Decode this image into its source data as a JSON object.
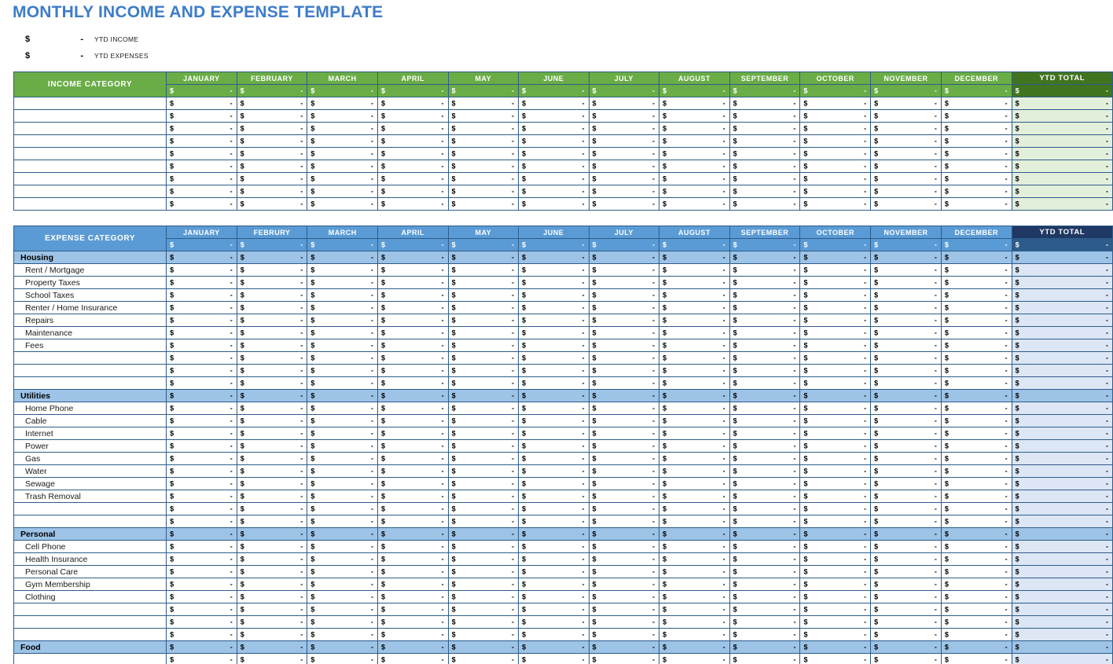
{
  "document": {
    "title": "MONTHLY INCOME AND EXPENSE TEMPLATE",
    "title_color": "#3d7cc9"
  },
  "summary": {
    "rows": [
      {
        "currency": "$",
        "amount": "-",
        "label": "YTD INCOME"
      },
      {
        "currency": "$",
        "amount": "-",
        "label": "YTD EXPENSES"
      }
    ]
  },
  "income_table": {
    "category_header": "INCOME CATEGORY",
    "months": [
      "JANUARY",
      "FEBRUARY",
      "MARCH",
      "APRIL",
      "MAY",
      "JUNE",
      "JULY",
      "AUGUST",
      "SEPTEMBER",
      "OCTOBER",
      "NOVEMBER",
      "DECEMBER"
    ],
    "ytd_header": "YTD TOTAL",
    "header_totals": [
      "-",
      "-",
      "-",
      "-",
      "-",
      "-",
      "-",
      "-",
      "-",
      "-",
      "-",
      "-"
    ],
    "ytd_header_total": "-",
    "currency": "$",
    "empty_value": "-",
    "theme": {
      "header_bg": "#6aad46",
      "ytd_header_bg": "#41741f",
      "ytd_cell_bg": "#e2efda",
      "border": "#2e5c8a"
    },
    "rows": [
      {
        "label": "",
        "values": [
          "-",
          "-",
          "-",
          "-",
          "-",
          "-",
          "-",
          "-",
          "-",
          "-",
          "-",
          "-"
        ],
        "ytd": "-"
      },
      {
        "label": "",
        "values": [
          "-",
          "-",
          "-",
          "-",
          "-",
          "-",
          "-",
          "-",
          "-",
          "-",
          "-",
          "-"
        ],
        "ytd": "-"
      },
      {
        "label": "",
        "values": [
          "-",
          "-",
          "-",
          "-",
          "-",
          "-",
          "-",
          "-",
          "-",
          "-",
          "-",
          "-"
        ],
        "ytd": "-"
      },
      {
        "label": "",
        "values": [
          "-",
          "-",
          "-",
          "-",
          "-",
          "-",
          "-",
          "-",
          "-",
          "-",
          "-",
          "-"
        ],
        "ytd": "-"
      },
      {
        "label": "",
        "values": [
          "-",
          "-",
          "-",
          "-",
          "-",
          "-",
          "-",
          "-",
          "-",
          "-",
          "-",
          "-"
        ],
        "ytd": "-"
      },
      {
        "label": "",
        "values": [
          "-",
          "-",
          "-",
          "-",
          "-",
          "-",
          "-",
          "-",
          "-",
          "-",
          "-",
          "-"
        ],
        "ytd": "-"
      },
      {
        "label": "",
        "values": [
          "-",
          "-",
          "-",
          "-",
          "-",
          "-",
          "-",
          "-",
          "-",
          "-",
          "-",
          "-"
        ],
        "ytd": "-"
      },
      {
        "label": "",
        "values": [
          "-",
          "-",
          "-",
          "-",
          "-",
          "-",
          "-",
          "-",
          "-",
          "-",
          "-",
          "-"
        ],
        "ytd": "-"
      },
      {
        "label": "",
        "values": [
          "-",
          "-",
          "-",
          "-",
          "-",
          "-",
          "-",
          "-",
          "-",
          "-",
          "-",
          "-"
        ],
        "ytd": "-"
      }
    ]
  },
  "expense_table": {
    "category_header": "EXPENSE CATEGORY",
    "months": [
      "JANUARY",
      "FEBRURY",
      "MARCH",
      "APRIL",
      "MAY",
      "JUNE",
      "JULY",
      "AUGUST",
      "SEPTEMBER",
      "OCTOBER",
      "NOVEMBER",
      "DECEMBER"
    ],
    "ytd_header": "YTD TOTAL",
    "header_totals": [
      "-",
      "-",
      "-",
      "-",
      "-",
      "-",
      "-",
      "-",
      "-",
      "-",
      "-",
      "-"
    ],
    "ytd_header_total": "-",
    "currency": "$",
    "empty_value": "-",
    "theme": {
      "header_bg": "#5b9bd5",
      "ytd_header_bg": "#1f3864",
      "ytd_cell_bg": "#dce6f4",
      "section_bg": "#9dc3e6",
      "border": "#2e5c8a"
    },
    "rows": [
      {
        "type": "section",
        "label": "Housing",
        "values": [
          "-",
          "-",
          "-",
          "-",
          "-",
          "-",
          "-",
          "-",
          "-",
          "-",
          "-",
          "-"
        ],
        "ytd": "-"
      },
      {
        "type": "item",
        "label": "Rent / Mortgage",
        "values": [
          "-",
          "-",
          "-",
          "-",
          "-",
          "-",
          "-",
          "-",
          "-",
          "-",
          "-",
          "-"
        ],
        "ytd": "-"
      },
      {
        "type": "item",
        "label": "Property Taxes",
        "values": [
          "-",
          "-",
          "-",
          "-",
          "-",
          "-",
          "-",
          "-",
          "-",
          "-",
          "-",
          "-"
        ],
        "ytd": "-"
      },
      {
        "type": "item",
        "label": "School Taxes",
        "values": [
          "-",
          "-",
          "-",
          "-",
          "-",
          "-",
          "-",
          "-",
          "-",
          "-",
          "-",
          "-"
        ],
        "ytd": "-"
      },
      {
        "type": "item",
        "label": "Renter / Home Insurance",
        "values": [
          "-",
          "-",
          "-",
          "-",
          "-",
          "-",
          "-",
          "-",
          "-",
          "-",
          "-",
          "-"
        ],
        "ytd": "-"
      },
      {
        "type": "item",
        "label": "Repairs",
        "values": [
          "-",
          "-",
          "-",
          "-",
          "-",
          "-",
          "-",
          "-",
          "-",
          "-",
          "-",
          "-"
        ],
        "ytd": "-"
      },
      {
        "type": "item",
        "label": "Maintenance",
        "values": [
          "-",
          "-",
          "-",
          "-",
          "-",
          "-",
          "-",
          "-",
          "-",
          "-",
          "-",
          "-"
        ],
        "ytd": "-"
      },
      {
        "type": "item",
        "label": "Fees",
        "values": [
          "-",
          "-",
          "-",
          "-",
          "-",
          "-",
          "-",
          "-",
          "-",
          "-",
          "-",
          "-"
        ],
        "ytd": "-"
      },
      {
        "type": "blank",
        "label": "",
        "values": [
          "-",
          "-",
          "-",
          "-",
          "-",
          "-",
          "-",
          "-",
          "-",
          "-",
          "-",
          "-"
        ],
        "ytd": "-"
      },
      {
        "type": "blank",
        "label": "",
        "values": [
          "-",
          "-",
          "-",
          "-",
          "-",
          "-",
          "-",
          "-",
          "-",
          "-",
          "-",
          "-"
        ],
        "ytd": "-"
      },
      {
        "type": "blank",
        "label": "",
        "values": [
          "-",
          "-",
          "-",
          "-",
          "-",
          "-",
          "-",
          "-",
          "-",
          "-",
          "-",
          "-"
        ],
        "ytd": "-"
      },
      {
        "type": "section",
        "label": "Utilities",
        "values": [
          "-",
          "-",
          "-",
          "-",
          "-",
          "-",
          "-",
          "-",
          "-",
          "-",
          "-",
          "-"
        ],
        "ytd": "-"
      },
      {
        "type": "item",
        "label": "Home Phone",
        "values": [
          "-",
          "-",
          "-",
          "-",
          "-",
          "-",
          "-",
          "-",
          "-",
          "-",
          "-",
          "-"
        ],
        "ytd": "-"
      },
      {
        "type": "item",
        "label": "Cable",
        "values": [
          "-",
          "-",
          "-",
          "-",
          "-",
          "-",
          "-",
          "-",
          "-",
          "-",
          "-",
          "-"
        ],
        "ytd": "-"
      },
      {
        "type": "item",
        "label": "Internet",
        "values": [
          "-",
          "-",
          "-",
          "-",
          "-",
          "-",
          "-",
          "-",
          "-",
          "-",
          "-",
          "-"
        ],
        "ytd": "-"
      },
      {
        "type": "item",
        "label": "Power",
        "values": [
          "-",
          "-",
          "-",
          "-",
          "-",
          "-",
          "-",
          "-",
          "-",
          "-",
          "-",
          "-"
        ],
        "ytd": "-"
      },
      {
        "type": "item",
        "label": "Gas",
        "values": [
          "-",
          "-",
          "-",
          "-",
          "-",
          "-",
          "-",
          "-",
          "-",
          "-",
          "-",
          "-"
        ],
        "ytd": "-"
      },
      {
        "type": "item",
        "label": "Water",
        "values": [
          "-",
          "-",
          "-",
          "-",
          "-",
          "-",
          "-",
          "-",
          "-",
          "-",
          "-",
          "-"
        ],
        "ytd": "-"
      },
      {
        "type": "item",
        "label": "Sewage",
        "values": [
          "-",
          "-",
          "-",
          "-",
          "-",
          "-",
          "-",
          "-",
          "-",
          "-",
          "-",
          "-"
        ],
        "ytd": "-"
      },
      {
        "type": "item",
        "label": "Trash Removal",
        "values": [
          "-",
          "-",
          "-",
          "-",
          "-",
          "-",
          "-",
          "-",
          "-",
          "-",
          "-",
          "-"
        ],
        "ytd": "-"
      },
      {
        "type": "blank",
        "label": "",
        "values": [
          "-",
          "-",
          "-",
          "-",
          "-",
          "-",
          "-",
          "-",
          "-",
          "-",
          "-",
          "-"
        ],
        "ytd": "-"
      },
      {
        "type": "blank",
        "label": "",
        "values": [
          "-",
          "-",
          "-",
          "-",
          "-",
          "-",
          "-",
          "-",
          "-",
          "-",
          "-",
          "-"
        ],
        "ytd": "-"
      },
      {
        "type": "section",
        "label": "Personal",
        "values": [
          "-",
          "-",
          "-",
          "-",
          "-",
          "-",
          "-",
          "-",
          "-",
          "-",
          "-",
          "-"
        ],
        "ytd": "-"
      },
      {
        "type": "item",
        "label": "Cell Phone",
        "values": [
          "-",
          "-",
          "-",
          "-",
          "-",
          "-",
          "-",
          "-",
          "-",
          "-",
          "-",
          "-"
        ],
        "ytd": "-"
      },
      {
        "type": "item",
        "label": "Health Insurance",
        "values": [
          "-",
          "-",
          "-",
          "-",
          "-",
          "-",
          "-",
          "-",
          "-",
          "-",
          "-",
          "-"
        ],
        "ytd": "-"
      },
      {
        "type": "item",
        "label": "Personal Care",
        "values": [
          "-",
          "-",
          "-",
          "-",
          "-",
          "-",
          "-",
          "-",
          "-",
          "-",
          "-",
          "-"
        ],
        "ytd": "-"
      },
      {
        "type": "item",
        "label": "Gym Membership",
        "values": [
          "-",
          "-",
          "-",
          "-",
          "-",
          "-",
          "-",
          "-",
          "-",
          "-",
          "-",
          "-"
        ],
        "ytd": "-"
      },
      {
        "type": "item",
        "label": "Clothing",
        "values": [
          "-",
          "-",
          "-",
          "-",
          "-",
          "-",
          "-",
          "-",
          "-",
          "-",
          "-",
          "-"
        ],
        "ytd": "-"
      },
      {
        "type": "blank",
        "label": "",
        "values": [
          "-",
          "-",
          "-",
          "-",
          "-",
          "-",
          "-",
          "-",
          "-",
          "-",
          "-",
          "-"
        ],
        "ytd": "-"
      },
      {
        "type": "blank",
        "label": "",
        "values": [
          "-",
          "-",
          "-",
          "-",
          "-",
          "-",
          "-",
          "-",
          "-",
          "-",
          "-",
          "-"
        ],
        "ytd": "-"
      },
      {
        "type": "blank",
        "label": "",
        "values": [
          "-",
          "-",
          "-",
          "-",
          "-",
          "-",
          "-",
          "-",
          "-",
          "-",
          "-",
          "-"
        ],
        "ytd": "-"
      },
      {
        "type": "section",
        "label": "Food",
        "values": [
          "-",
          "-",
          "-",
          "-",
          "-",
          "-",
          "-",
          "-",
          "-",
          "-",
          "-",
          "-"
        ],
        "ytd": "-"
      },
      {
        "type": "item",
        "label": "",
        "values": [
          "-",
          "-",
          "-",
          "-",
          "-",
          "-",
          "-",
          "-",
          "-",
          "-",
          "-",
          "-"
        ],
        "ytd": "-"
      }
    ]
  }
}
